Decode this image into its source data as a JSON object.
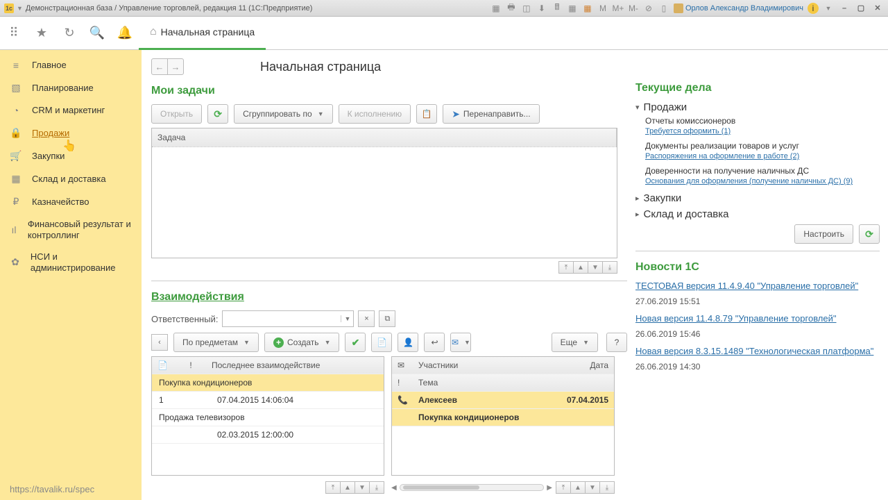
{
  "titlebar": {
    "logo": "1c",
    "title": "Демонстрационная база / Управление торговлей, редакция 11 (1С:Предприятие)",
    "user": "Орлов Александр Владимирович",
    "m_labels": [
      "M",
      "M+",
      "M-"
    ]
  },
  "topnav": {
    "tab": "Начальная страница"
  },
  "sidebar": {
    "items": [
      {
        "icon": "≡",
        "label": "Главное"
      },
      {
        "icon": "▧",
        "label": "Планирование"
      },
      {
        "icon": "◔",
        "label": "CRM и маркетинг"
      },
      {
        "icon": "🔒",
        "label": "Продажи",
        "active": true
      },
      {
        "icon": "🛒",
        "label": "Закупки"
      },
      {
        "icon": "▦",
        "label": "Склад и доставка"
      },
      {
        "icon": "₽",
        "label": "Казначейство"
      },
      {
        "icon": "ıl",
        "label": "Финансовый результат и контроллинг"
      },
      {
        "icon": "✿",
        "label": "НСИ и администрирование"
      }
    ],
    "footer": "https://tavalik.ru/spec"
  },
  "page": {
    "title": "Начальная страница"
  },
  "tasks": {
    "title": "Мои задачи",
    "open_btn": "Открыть",
    "group_btn": "Сгруппировать по",
    "due_btn": "К исполнению",
    "forward_btn": "Перенаправить...",
    "header": "Задача"
  },
  "interactions": {
    "title": "Взаимодействия",
    "responsible_label": "Ответственный:",
    "by_subject": "По предметам",
    "create": "Создать",
    "more": "Еще",
    "help": "?",
    "left_cols": {
      "c1": "📄",
      "c2": "!",
      "c3": "Последнее взаимодействие"
    },
    "left_rows": [
      {
        "subject": "Покупка кондиционеров",
        "selected": true
      },
      {
        "count": "1",
        "date": "07.04.2015 14:06:04"
      },
      {
        "subject": "Продажа телевизоров"
      },
      {
        "count": "",
        "date": "02.03.2015 12:00:00"
      }
    ],
    "right_cols": {
      "c1": "✉",
      "c2": "Участники",
      "c3": "Дата"
    },
    "right_cols2": {
      "c1": "!",
      "c2": "Тема"
    },
    "right_rows": [
      {
        "icon": "📞",
        "name": "Алексеев",
        "date": "07.04.2015",
        "selected": true
      },
      {
        "subject": "Покупка кондиционеров",
        "selected": true
      }
    ]
  },
  "current": {
    "title": "Текущие дела",
    "sales": "Продажи",
    "items": [
      {
        "t": "Отчеты комиссионеров",
        "l": "Требуется оформить (1)"
      },
      {
        "t": "Документы реализации товаров и услуг",
        "l": "Распоряжения на оформление в работе (2)"
      },
      {
        "t": "Доверенности на получение наличных ДС",
        "l": "Основания для оформления (получение наличных ДС) (9)"
      }
    ],
    "collapsed": [
      "Закупки",
      "Склад и доставка"
    ],
    "configure": "Настроить"
  },
  "news": {
    "title": "Новости 1С",
    "items": [
      {
        "t": "ТЕСТОВАЯ версия 11.4.9.40 \"Управление торговлей\"",
        "d": "27.06.2019 15:51"
      },
      {
        "t": "Новая версия 11.4.8.79 \"Управление торговлей\"",
        "d": "26.06.2019 15:46"
      },
      {
        "t": "Новая версия 8.3.15.1489 \"Технологическая платформа\"",
        "d": "26.06.2019 14:30"
      }
    ]
  }
}
